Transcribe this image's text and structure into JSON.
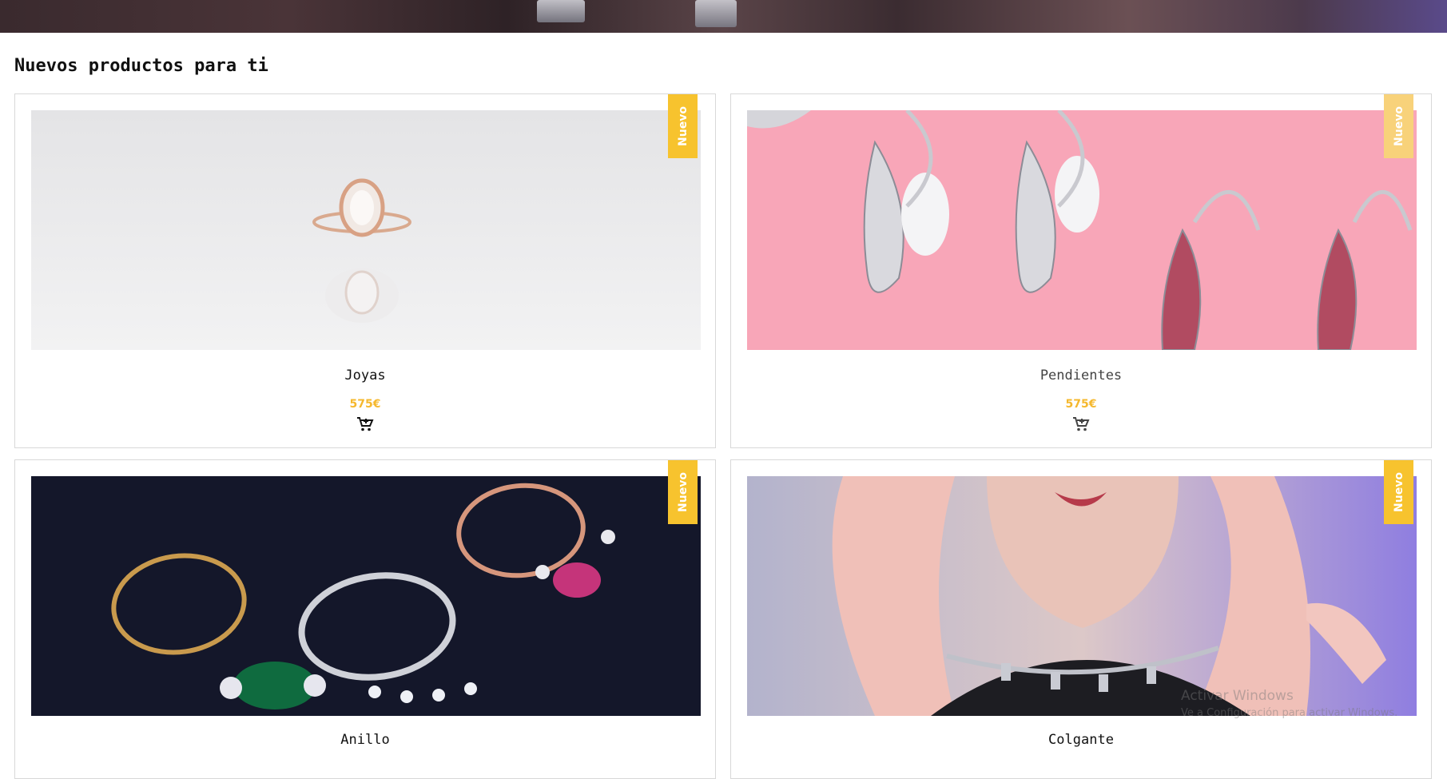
{
  "section": {
    "title": "Nuevos productos para ti"
  },
  "products": [
    {
      "name": "Joyas",
      "price": "575€",
      "badge": "Nuevo",
      "image": "rose-gold-oval-diamond-ring-on-white"
    },
    {
      "name": "Pendientes",
      "price": "575€",
      "badge": "Nuevo",
      "image": "crystal-drop-earrings-on-pink"
    },
    {
      "name": "Anillo",
      "price": "",
      "badge": "Nuevo",
      "image": "three-gemstone-rings-on-dark-background"
    },
    {
      "name": "Colgante",
      "price": "",
      "badge": "Nuevo",
      "image": "woman-wearing-chain-choker"
    }
  ],
  "watermark": {
    "line1": "Activar Windows",
    "line2": "Ve a Configuración para activar Windows."
  },
  "icons": {
    "cart": "cart-plus-icon"
  },
  "colors": {
    "accent": "#f7c32e",
    "price": "#f5b82e"
  }
}
